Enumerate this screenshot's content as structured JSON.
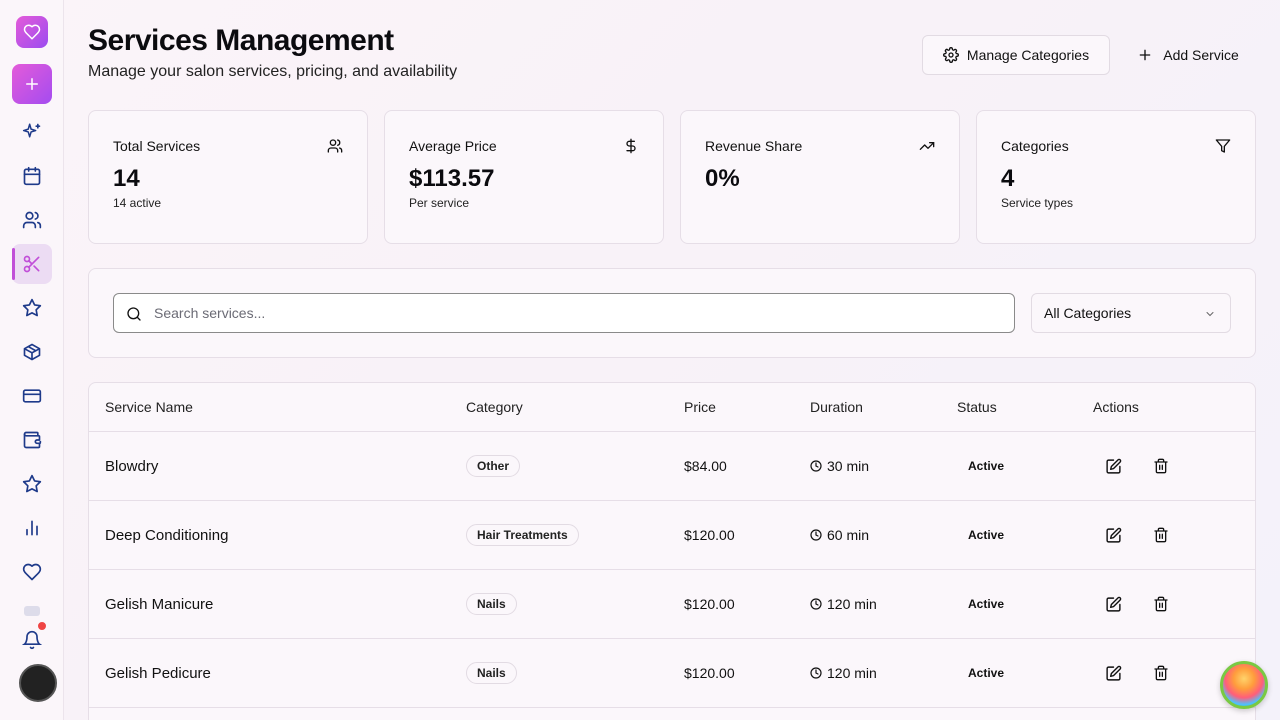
{
  "header": {
    "title": "Services Management",
    "subtitle": "Manage your salon services, pricing, and availability",
    "manage_categories_label": "Manage Categories",
    "add_service_label": "Add Service"
  },
  "sidebar": {
    "items": [
      {
        "icon": "sparkles-icon"
      },
      {
        "icon": "calendar-icon"
      },
      {
        "icon": "users-icon"
      },
      {
        "icon": "scissors-icon",
        "active": true
      },
      {
        "icon": "star-icon"
      },
      {
        "icon": "package-icon"
      },
      {
        "icon": "credit-card-icon"
      },
      {
        "icon": "wallet-icon"
      },
      {
        "icon": "star-icon"
      },
      {
        "icon": "bar-chart-icon"
      },
      {
        "icon": "heart-icon"
      }
    ],
    "notification_badge": true
  },
  "stats": [
    {
      "label": "Total Services",
      "value": "14",
      "sub": "14 active",
      "icon": "users-icon"
    },
    {
      "label": "Average Price",
      "value": "$113.57",
      "sub": "Per service",
      "icon": "dollar-icon"
    },
    {
      "label": "Revenue Share",
      "value": "0%",
      "sub": "",
      "icon": "trending-up-icon"
    },
    {
      "label": "Categories",
      "value": "4",
      "sub": "Service types",
      "icon": "filter-icon"
    }
  ],
  "filters": {
    "search_placeholder": "Search services...",
    "search_value": "",
    "category_selected": "All Categories"
  },
  "table": {
    "columns": [
      "Service Name",
      "Category",
      "Price",
      "Duration",
      "Status",
      "Actions"
    ],
    "rows": [
      {
        "name": "Blowdry",
        "category": "Other",
        "price": "$84.00",
        "duration": "30 min",
        "status": "Active"
      },
      {
        "name": "Deep Conditioning",
        "category": "Hair Treatments",
        "price": "$120.00",
        "duration": "60 min",
        "status": "Active"
      },
      {
        "name": "Gelish Manicure",
        "category": "Nails",
        "price": "$120.00",
        "duration": "120 min",
        "status": "Active"
      },
      {
        "name": "Gelish Pedicure",
        "category": "Nails",
        "price": "$120.00",
        "duration": "120 min",
        "status": "Active"
      }
    ]
  },
  "colors": {
    "accent": "#c14fd8",
    "icon_blue": "#1e3a8a",
    "notification": "#ef4444"
  }
}
